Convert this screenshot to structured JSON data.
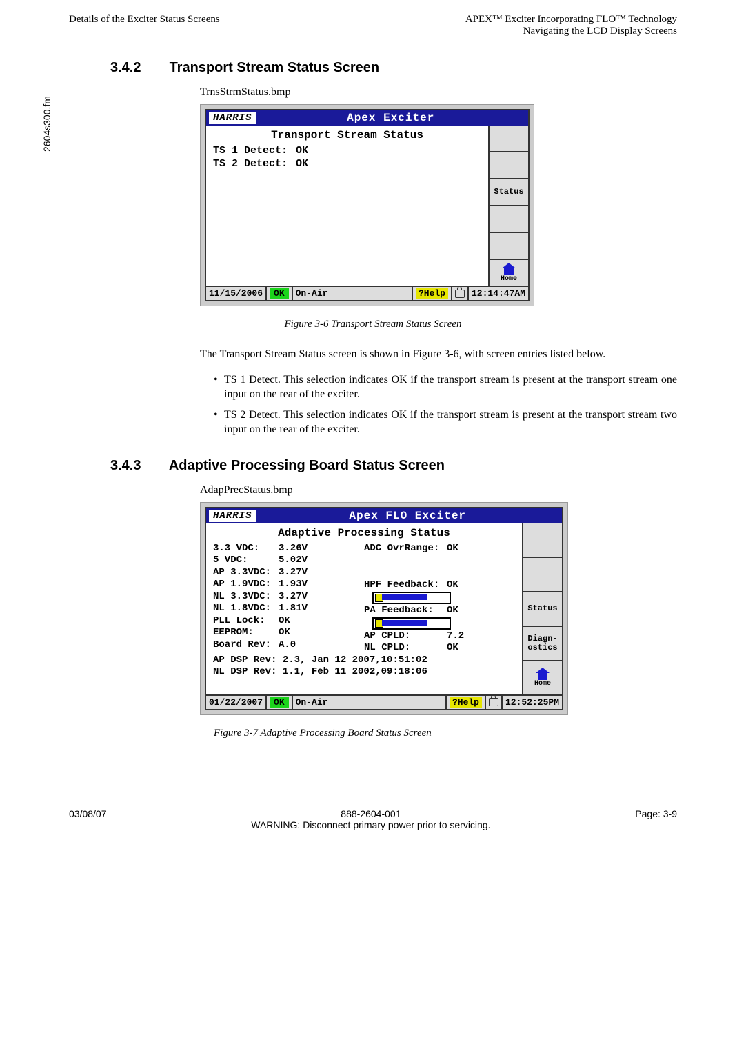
{
  "header": {
    "left": "Details of the Exciter Status Screens",
    "right_top": "APEX™ Exciter Incorporating FLO™ Technology",
    "right_bottom": "Navigating the LCD Display Screens"
  },
  "side_file": "2604s300.fm",
  "section1": {
    "num": "3.4.2",
    "title": "Transport Stream Status Screen",
    "filename": "TrnsStrmStatus.bmp",
    "caption": "Figure 3-6  Transport Stream Status Screen",
    "intro": "The Transport Stream Status screen is shown in Figure 3-6, with screen entries listed below.",
    "bullets": [
      "TS 1 Detect. This selection indicates OK if the transport stream is present at the transport stream one input on the rear of the exciter.",
      "TS 2 Detect. This selection indicates OK if the transport stream is present at the transport stream two input on the rear of the exciter."
    ]
  },
  "section2": {
    "num": "3.4.3",
    "title": "Adaptive Processing Board Status Screen",
    "filename": "AdapPrecStatus.bmp",
    "caption": "Figure 3-7  Adaptive Processing Board Status Screen"
  },
  "lcd1": {
    "logo": "HARRIS",
    "title": "Apex Exciter",
    "subtitle": "Transport Stream Status",
    "rows": [
      {
        "label": "TS 1 Detect:",
        "value": "OK"
      },
      {
        "label": "TS 2 Detect:",
        "value": "OK"
      }
    ],
    "side": [
      "",
      "",
      "Status",
      "",
      "",
      "Home"
    ],
    "status": {
      "date": "11/15/2006",
      "ok": "OK",
      "air": "On-Air",
      "help": "?Help",
      "time": "12:14:47AM"
    }
  },
  "lcd2": {
    "logo": "HARRIS",
    "title": "Apex FLO Exciter",
    "subtitle": "Adaptive Processing Status",
    "col1": [
      {
        "label": "3.3 VDC:",
        "value": "3.26V"
      },
      {
        "label": "5 VDC:",
        "value": "5.02V"
      },
      {
        "label": "AP 3.3VDC:",
        "value": "3.27V"
      },
      {
        "label": "AP 1.9VDC:",
        "value": "1.93V"
      },
      {
        "label": "NL 3.3VDC:",
        "value": "3.27V"
      },
      {
        "label": "NL 1.8VDC:",
        "value": "1.81V"
      },
      {
        "label": "PLL Lock:",
        "value": "OK"
      },
      {
        "label": "EEPROM:",
        "value": "OK"
      },
      {
        "label": "Board Rev:",
        "value": "A.0"
      }
    ],
    "col2": [
      {
        "label": "ADC OvrRange:",
        "value": "OK"
      },
      {
        "label": "HPF Feedback:",
        "value": "OK"
      },
      {
        "label": "PA Feedback:",
        "value": "OK"
      },
      {
        "label": "AP CPLD:",
        "value": "7.2"
      },
      {
        "label": "NL CPLD:",
        "value": "OK"
      }
    ],
    "full_rows": [
      "AP DSP Rev: 2.3, Jan 12 2007,10:51:02",
      "NL DSP Rev: 1.1, Feb 11 2002,09:18:06"
    ],
    "side": [
      "",
      "",
      "Status",
      "Diagn-ostics",
      "Home"
    ],
    "status": {
      "date": "01/22/2007",
      "ok": "OK",
      "air": "On-Air",
      "help": "?Help",
      "time": "12:52:25PM"
    }
  },
  "footer": {
    "left": "03/08/07",
    "center": "888-2604-001",
    "right": "Page: 3-9",
    "warning": "WARNING: Disconnect primary power prior to servicing."
  }
}
